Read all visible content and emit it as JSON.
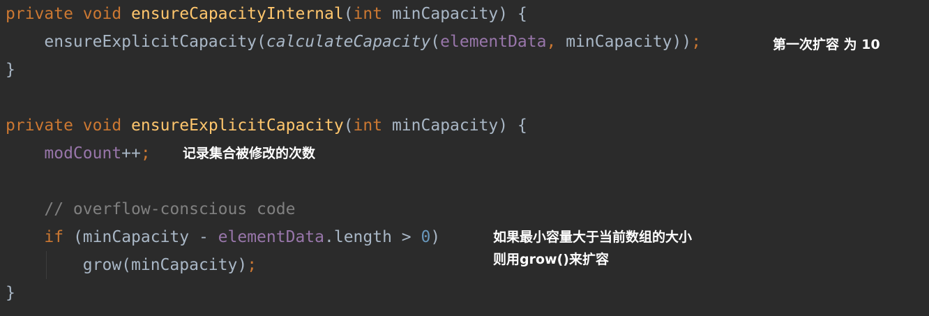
{
  "code": {
    "l1": {
      "kw_private": "private",
      "kw_void": "void",
      "fn_name": "ensureCapacityInternal",
      "open": "(",
      "kw_int": "int",
      "param": "minCapacity",
      "close": ") {"
    },
    "l2": {
      "call": "ensureExplicitCapacity",
      "open": "(",
      "inner_call": "calculateCapacity",
      "open2": "(",
      "field": "elementData",
      "comma": ",",
      "arg": "minCapacity",
      "close": "))",
      "semi": ";"
    },
    "l3": {
      "brace": "}"
    },
    "l5": {
      "kw_private": "private",
      "kw_void": "void",
      "fn_name": "ensureExplicitCapacity",
      "open": "(",
      "kw_int": "int",
      "param": "minCapacity",
      "close": ") {"
    },
    "l6": {
      "field": "modCount",
      "op": "++",
      "semi": ";"
    },
    "l8": {
      "comment": "// overflow-conscious code"
    },
    "l9": {
      "kw_if": "if",
      "open": "(minCapacity - ",
      "field": "elementData",
      "dot_len": ".length > ",
      "num": "0",
      "close": ")"
    },
    "l10": {
      "call": "grow(minCapacity)",
      "semi": ";"
    },
    "l11": {
      "brace": "}"
    }
  },
  "annotations": {
    "first_expand": "第一次扩容 为 10",
    "modcount": "记录集合被修改的次数",
    "grow_line1": "如果最小容量大于当前数组的大小",
    "grow_line2": "则用grow()来扩容"
  },
  "colors": {
    "background": "#2b2b2b",
    "keyword": "#cc7832",
    "function": "#ffc66d",
    "field": "#9876aa",
    "number": "#6897bb",
    "comment": "#808080",
    "text": "#a9b7c6"
  }
}
